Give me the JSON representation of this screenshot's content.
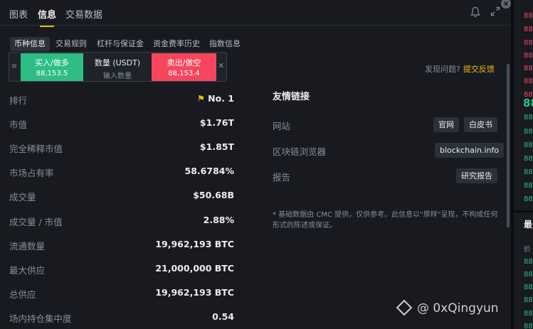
{
  "top_tabs": [
    "图表",
    "信息",
    "交易数据"
  ],
  "sub_tabs": [
    "币种信息",
    "交易规则",
    "杠杆与保证金",
    "资金费率历史",
    "指数信息"
  ],
  "trade_bar": {
    "buy_label": "买入/做多",
    "buy_price": "88,153.5",
    "qty_label": "数量 (USDT)",
    "qty_placeholder": "输入数量",
    "sell_label": "卖出/做空",
    "sell_price": "88,153.4"
  },
  "feedback": {
    "text": "发现问题?",
    "link": "提交反馈"
  },
  "stats": [
    {
      "label": "排行",
      "value": "No. 1"
    },
    {
      "label": "市值",
      "value": "$1.76T"
    },
    {
      "label": "完全稀释市值",
      "value": "$1.85T"
    },
    {
      "label": "市场占有率",
      "value": "58.6784%"
    },
    {
      "label": "成交量",
      "value": "$50.68B"
    },
    {
      "label": "成交量 / 市值",
      "value": "2.88%"
    },
    {
      "label": "流通数量",
      "value": "19,962,193 BTC"
    },
    {
      "label": "最大供应",
      "value": "21,000,000 BTC"
    },
    {
      "label": "总供应",
      "value": "19,962,193 BTC"
    },
    {
      "label": "场内持仓集中度",
      "value": "0.54"
    }
  ],
  "links": {
    "title": "友情链接",
    "website_label": "网站",
    "website_official": "官网",
    "website_whitepaper": "白皮书",
    "explorer_label": "区块链浏览器",
    "explorer_value": "blockchain.info",
    "report_label": "报告",
    "report_value": "研究报告",
    "note": "* 基础数据由 CMC 提供，仅供参考。此信息以\"原样\"呈现，不构成任何形式的陈述或保证。"
  },
  "right_column": {
    "prices": [
      "88",
      "88",
      "88",
      "88",
      "88",
      "88",
      "88",
      "88",
      "88",
      "88",
      "88",
      "88",
      "88",
      "88",
      "88",
      "88",
      "88",
      "88",
      "88",
      "88",
      "88",
      "88",
      "88"
    ],
    "big_price": "88",
    "recent_title": "最",
    "recent_sub": "价"
  },
  "watermark": "@ 0xQingyun",
  "colors": {
    "buy": "#2ebd85",
    "sell": "#f6465d",
    "accent": "#f0b90b"
  }
}
